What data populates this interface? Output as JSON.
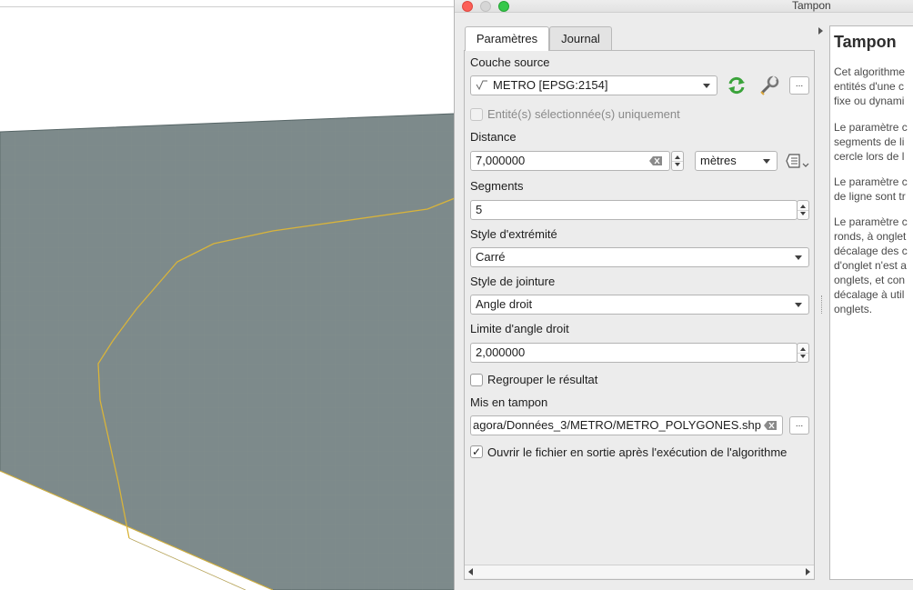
{
  "window": {
    "title": "Tampon"
  },
  "tabs": [
    {
      "label": "Paramètres"
    },
    {
      "label": "Journal"
    }
  ],
  "form": {
    "source_layer": {
      "label": "Couche source",
      "value": "METRO [EPSG:2154]"
    },
    "selected_only": {
      "label": "Entité(s) sélectionnée(s) uniquement",
      "checked": false
    },
    "distance": {
      "label": "Distance",
      "value": "7,000000",
      "unit": "mètres"
    },
    "segments": {
      "label": "Segments",
      "value": "5"
    },
    "end_cap": {
      "label": "Style d'extrémité",
      "value": "Carré"
    },
    "join_style": {
      "label": "Style de jointure",
      "value": "Angle droit"
    },
    "miter_limit": {
      "label": "Limite d'angle droit",
      "value": "2,000000"
    },
    "dissolve": {
      "label": "Regrouper le résultat",
      "checked": false
    },
    "output": {
      "label": "Mis en tampon",
      "value": "agora/Données_3/METRO/METRO_POLYGONES.shp"
    },
    "open_output": {
      "label": "Ouvrir le fichier en sortie après l'exécution de l'algorithme",
      "checked": true
    },
    "ellipsis": "..."
  },
  "help": {
    "title": "Tampon",
    "p1": "Cet algorithme\nentités d'une c\nfixe ou dynami",
    "p2": "Le paramètre c\nsegments de li\ncercle lors de l",
    "p3": "Le paramètre c\nde ligne sont tr",
    "p4": "Le paramètre c\nronds, à onglet\ndécalage des c\nd'onglet n'est a\nonglets, et con\ndécalage à util\nonglets."
  },
  "colors": {
    "map_fill": "#7d8a8b",
    "boundary": "#d9b43a",
    "refresh_icon": "#3aa33a"
  }
}
